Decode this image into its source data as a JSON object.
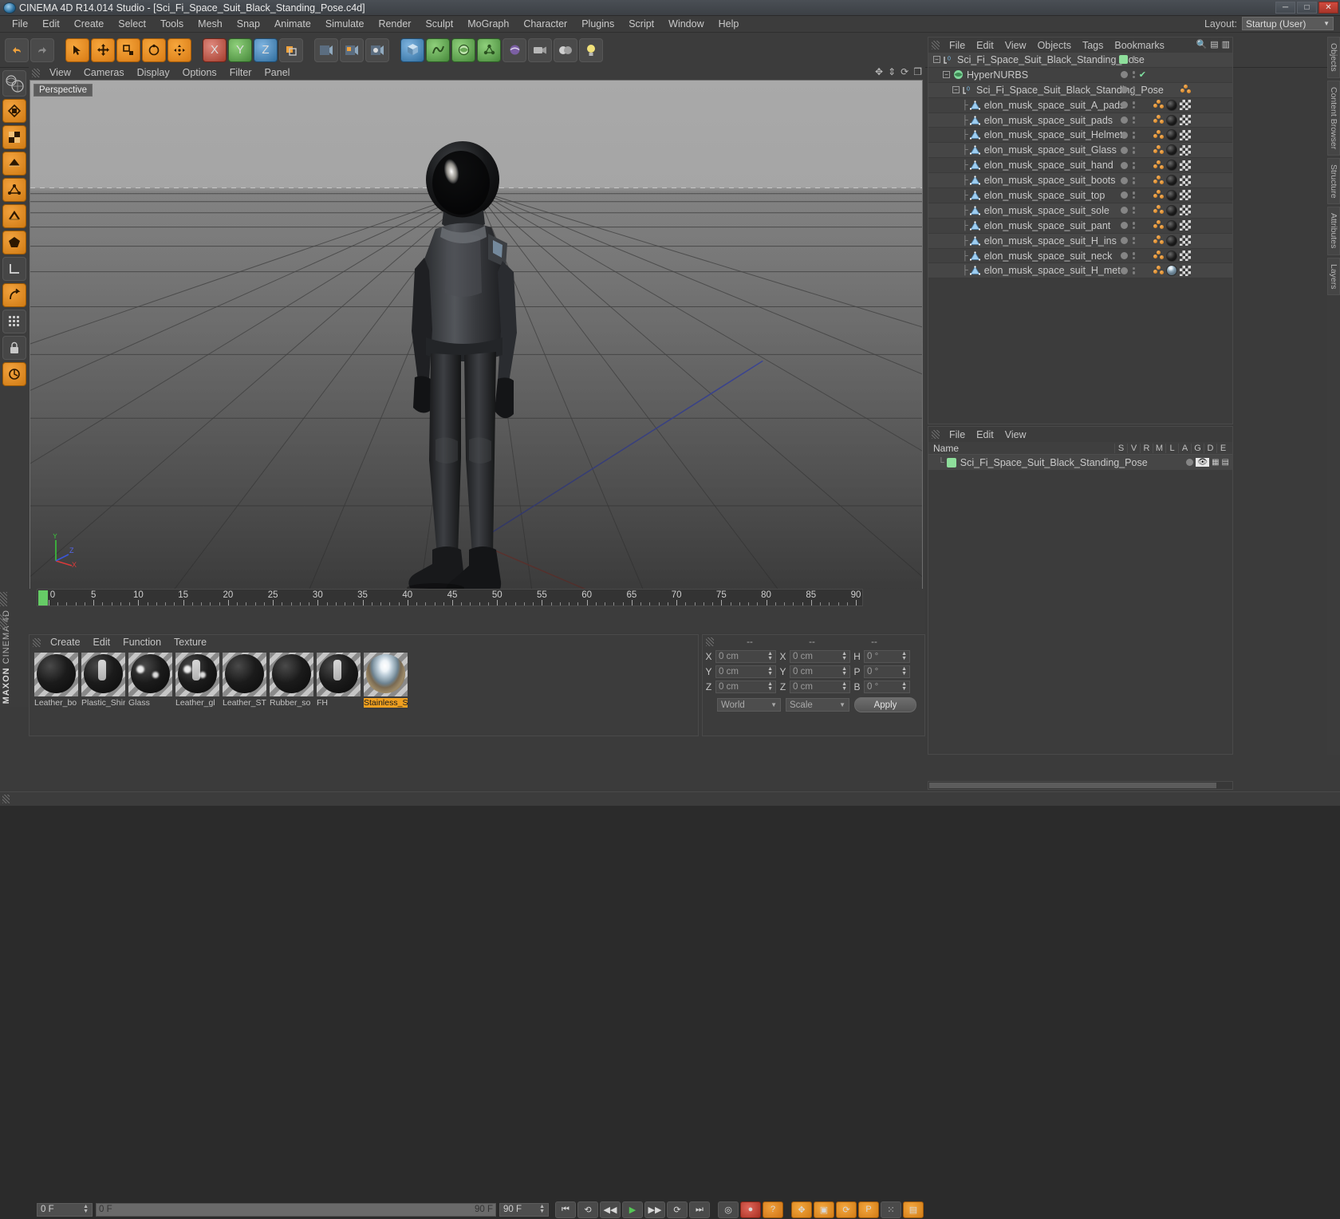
{
  "titlebar": {
    "title": "CINEMA 4D R14.014 Studio - [Sci_Fi_Space_Suit_Black_Standing_Pose.c4d]",
    "minimize": "─",
    "maximize": "□",
    "close": "✕"
  },
  "menubar": {
    "items": [
      "File",
      "Edit",
      "Create",
      "Select",
      "Tools",
      "Mesh",
      "Snap",
      "Animate",
      "Simulate",
      "Render",
      "Sculpt",
      "MoGraph",
      "Character",
      "Plugins",
      "Script",
      "Window",
      "Help"
    ],
    "layout_label": "Layout:",
    "layout_value": "Startup (User)"
  },
  "viewport": {
    "menu": [
      "View",
      "Cameras",
      "Display",
      "Options",
      "Filter",
      "Panel"
    ],
    "label": "Perspective",
    "axis": {
      "x": "X",
      "y": "Y",
      "z": "Z"
    }
  },
  "timeline": {
    "ticks": [
      0,
      5,
      10,
      15,
      20,
      25,
      30,
      35,
      40,
      45,
      50,
      55,
      60,
      65,
      70,
      75,
      80,
      85,
      90
    ],
    "current_frame": "0 F",
    "start_frame": "0 F",
    "end_frame": "90 F",
    "preview_end": "90 F",
    "right_field": "0 F"
  },
  "materials": {
    "menu": [
      "Create",
      "Edit",
      "Function",
      "Texture"
    ],
    "items": [
      {
        "name": "Leather_bo",
        "style": "matte",
        "selected": false
      },
      {
        "name": "Plastic_Shir",
        "style": "strip",
        "selected": false
      },
      {
        "name": "Glass",
        "style": "spec",
        "selected": false
      },
      {
        "name": "Leather_gl",
        "style": "strip2",
        "selected": false
      },
      {
        "name": "Leather_ST",
        "style": "rough",
        "selected": false
      },
      {
        "name": "Rubber_so",
        "style": "matte",
        "selected": false
      },
      {
        "name": "FH",
        "style": "strip",
        "selected": false
      },
      {
        "name": "Stainless_S",
        "style": "hdri",
        "selected": true
      }
    ]
  },
  "coordinates": {
    "headers": [
      "--",
      "--",
      "--"
    ],
    "position": {
      "x": "0 cm",
      "y": "0 cm",
      "z": "0 cm"
    },
    "size": {
      "x": "0 cm",
      "y": "0 cm",
      "z": "0 cm"
    },
    "rotation": {
      "h": "0 °",
      "p": "0 °",
      "b": "0 °"
    },
    "axis_labels": {
      "x": "X",
      "y": "Y",
      "z": "Z",
      "h": "H",
      "p": "P",
      "b": "B"
    },
    "space": "World",
    "mode": "Scale",
    "apply": "Apply"
  },
  "object_manager": {
    "menu": [
      "File",
      "Edit",
      "View",
      "Objects",
      "Tags",
      "Bookmarks"
    ],
    "rows": [
      {
        "label": "Sci_Fi_Space_Suit_Black_Standing_Pose",
        "depth": 0,
        "icon": "null-object-icon",
        "expander": true,
        "visdot": "green",
        "check": false,
        "tags": []
      },
      {
        "label": "HyperNURBS",
        "depth": 1,
        "icon": "hypernurbs-icon",
        "expander": true,
        "visdot": "grey",
        "check": true,
        "tags": []
      },
      {
        "label": "Sci_Fi_Space_Suit_Black_Standing_Pose",
        "depth": 2,
        "icon": "null-object-icon",
        "expander": true,
        "visdot": "grey",
        "check": false,
        "tags": [
          "point"
        ]
      },
      {
        "label": "elon_musk_space_suit_A_pads",
        "depth": 3,
        "icon": "polygon-object-icon",
        "expander": false,
        "visdot": "grey",
        "check": false,
        "tags": [
          "point",
          "material",
          "uvw"
        ]
      },
      {
        "label": "elon_musk_space_suit_pads",
        "depth": 3,
        "icon": "polygon-object-icon",
        "expander": false,
        "visdot": "grey",
        "check": false,
        "tags": [
          "point",
          "material",
          "uvw"
        ]
      },
      {
        "label": "elon_musk_space_suit_Helmet",
        "depth": 3,
        "icon": "polygon-object-icon",
        "expander": false,
        "visdot": "grey",
        "check": false,
        "tags": [
          "point",
          "material",
          "uvw"
        ]
      },
      {
        "label": "elon_musk_space_suit_Glass",
        "depth": 3,
        "icon": "polygon-object-icon",
        "expander": false,
        "visdot": "grey",
        "check": false,
        "tags": [
          "point",
          "material",
          "uvw"
        ]
      },
      {
        "label": "elon_musk_space_suit_hand",
        "depth": 3,
        "icon": "polygon-object-icon",
        "expander": false,
        "visdot": "grey",
        "check": false,
        "tags": [
          "point",
          "material",
          "uvw"
        ]
      },
      {
        "label": "elon_musk_space_suit_boots",
        "depth": 3,
        "icon": "polygon-object-icon",
        "expander": false,
        "visdot": "grey",
        "check": false,
        "tags": [
          "point",
          "material",
          "uvw"
        ]
      },
      {
        "label": "elon_musk_space_suit_top",
        "depth": 3,
        "icon": "polygon-object-icon",
        "expander": false,
        "visdot": "grey",
        "check": false,
        "tags": [
          "point",
          "material",
          "uvw"
        ]
      },
      {
        "label": "elon_musk_space_suit_sole",
        "depth": 3,
        "icon": "polygon-object-icon",
        "expander": false,
        "visdot": "grey",
        "check": false,
        "tags": [
          "point",
          "material",
          "uvw"
        ]
      },
      {
        "label": "elon_musk_space_suit_pant",
        "depth": 3,
        "icon": "polygon-object-icon",
        "expander": false,
        "visdot": "grey",
        "check": false,
        "tags": [
          "point",
          "material",
          "uvw"
        ]
      },
      {
        "label": "elon_musk_space_suit_H_ins",
        "depth": 3,
        "icon": "polygon-object-icon",
        "expander": false,
        "visdot": "grey",
        "check": false,
        "tags": [
          "point",
          "material",
          "uvw"
        ]
      },
      {
        "label": "elon_musk_space_suit_neck",
        "depth": 3,
        "icon": "polygon-object-icon",
        "expander": false,
        "visdot": "grey",
        "check": false,
        "tags": [
          "point",
          "material",
          "uvw"
        ]
      },
      {
        "label": "elon_musk_space_suit_H_met",
        "depth": 3,
        "icon": "polygon-object-icon",
        "expander": false,
        "visdot": "grey",
        "check": false,
        "tags": [
          "point",
          "material-globe",
          "uvw"
        ]
      }
    ]
  },
  "layer_manager": {
    "menu": [
      "File",
      "Edit",
      "View"
    ],
    "columns": [
      "Name",
      "S",
      "V",
      "R",
      "M",
      "L",
      "A",
      "G",
      "D",
      "E"
    ],
    "rows": [
      {
        "name": "Sci_Fi_Space_Suit_Black_Standing_Pose",
        "color": "#8ede9b"
      }
    ]
  },
  "right_tabs": [
    "Objects",
    "Content Browser",
    "Structure",
    "Attributes",
    "Layers"
  ],
  "colors": {
    "accent_orange": "#f0a020",
    "layer_green": "#8ede9b",
    "timeline_green": "#66cc66",
    "panel_bg": "#3c3c3c",
    "row_odd": "#464646",
    "row_even": "#414141"
  }
}
